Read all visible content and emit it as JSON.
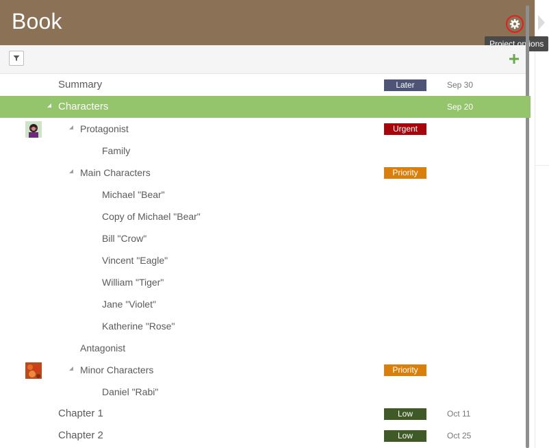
{
  "app": {
    "title": "Book"
  },
  "header": {
    "options_tooltip": "Project options"
  },
  "toolbar": {
    "filter_icon": "filter-icon",
    "add_icon": "plus-icon"
  },
  "colors": {
    "header_bg": "#8b7256",
    "selected_row": "#94c46b",
    "later": "#4d5475",
    "urgent": "#a5050b",
    "priority": "#d97f0c",
    "low": "#3f5a26"
  },
  "rows": [
    {
      "label": "Summary",
      "level": 0,
      "badge": "Later",
      "badge_color": "#4d5475",
      "date": "Sep 30"
    },
    {
      "label": "Characters",
      "level": 0,
      "expanded": true,
      "selected": true,
      "date": "Sep 20"
    },
    {
      "label": "Protagonist",
      "level": 1,
      "expanded": true,
      "badge": "Urgent",
      "badge_color": "#a5050b",
      "avatar": "avatar-person"
    },
    {
      "label": "Family",
      "level": 2
    },
    {
      "label": "Main Characters",
      "level": 1,
      "expanded": true,
      "badge": "Priority",
      "badge_color": "#d97f0c"
    },
    {
      "label": "Michael \"Bear\"",
      "level": 2
    },
    {
      "label": "Copy of Michael \"Bear\"",
      "level": 2
    },
    {
      "label": "Bill \"Crow\"",
      "level": 2
    },
    {
      "label": "Vincent \"Eagle\"",
      "level": 2
    },
    {
      "label": "William \"Tiger\"",
      "level": 2
    },
    {
      "label": "Jane \"Violet\"",
      "level": 2
    },
    {
      "label": "Katherine \"Rose\"",
      "level": 2
    },
    {
      "label": "Antagonist",
      "level": 1
    },
    {
      "label": "Minor Characters",
      "level": 1,
      "expanded": true,
      "badge": "Priority",
      "badge_color": "#d97f0c",
      "avatar": "avatar-flowers"
    },
    {
      "label": "Daniel \"Rabi\"",
      "level": 2
    },
    {
      "label": "Chapter 1",
      "level": 0,
      "badge": "Low",
      "badge_color": "#3f5a26",
      "date": "Oct 11"
    },
    {
      "label": "Chapter 2",
      "level": 0,
      "badge": "Low",
      "badge_color": "#3f5a26",
      "date": "Oct 25"
    }
  ]
}
